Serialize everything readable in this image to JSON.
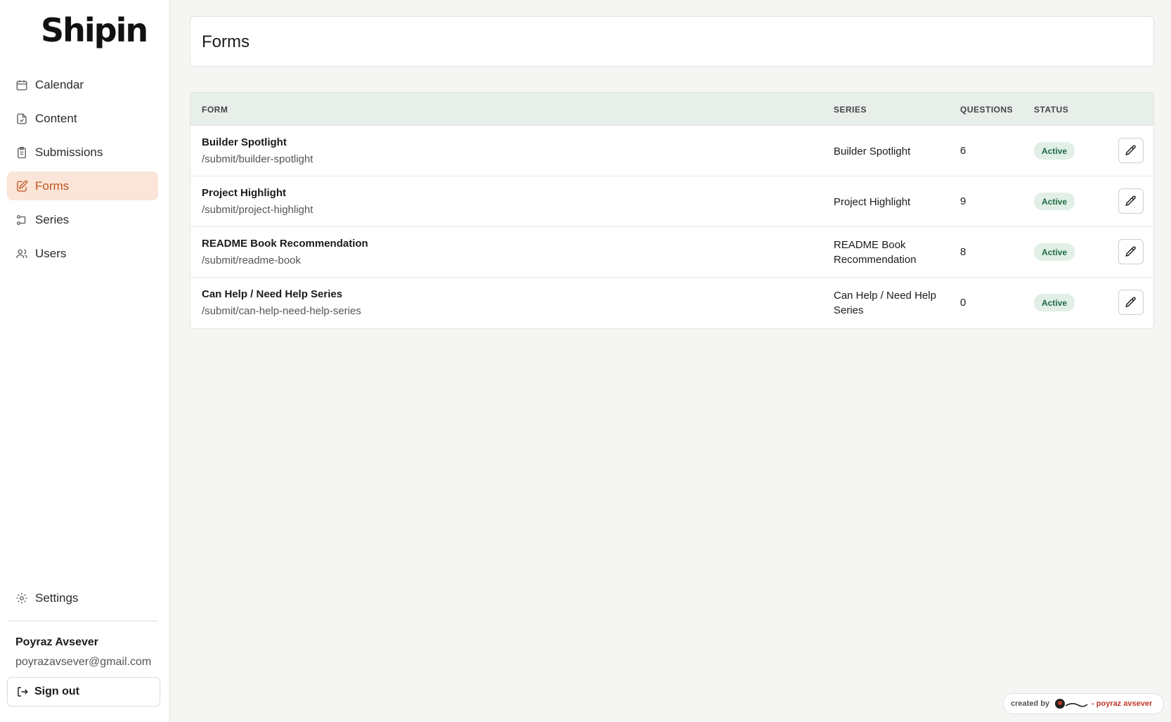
{
  "app": {
    "logo_text": "Shipin"
  },
  "sidebar": {
    "items": [
      {
        "label": "Calendar",
        "icon": "calendar-icon",
        "active": false
      },
      {
        "label": "Content",
        "icon": "document-icon",
        "active": false
      },
      {
        "label": "Submissions",
        "icon": "clipboard-icon",
        "active": false
      },
      {
        "label": "Forms",
        "icon": "edit-form-icon",
        "active": true
      },
      {
        "label": "Series",
        "icon": "series-icon",
        "active": false
      },
      {
        "label": "Users",
        "icon": "users-icon",
        "active": false
      }
    ],
    "settings_label": "Settings",
    "user": {
      "name": "Poyraz Avsever",
      "email": "poyrazavsever@gmail.com"
    },
    "signout_label": "Sign out"
  },
  "page": {
    "title": "Forms"
  },
  "table": {
    "headers": {
      "form": "FORM",
      "series": "SERIES",
      "questions": "QUESTIONS",
      "status": "STATUS"
    },
    "rows": [
      {
        "name": "Builder Spotlight",
        "path": "/submit/builder-spotlight",
        "series": "Builder Spotlight",
        "questions": "6",
        "status": "Active"
      },
      {
        "name": "Project Highlight",
        "path": "/submit/project-highlight",
        "series": "Project Highlight",
        "questions": "9",
        "status": "Active"
      },
      {
        "name": "README Book Recommendation",
        "path": "/submit/readme-book",
        "series": "README Book Recommendation",
        "questions": "8",
        "status": "Active"
      },
      {
        "name": "Can Help / Need Help Series",
        "path": "/submit/can-help-need-help-series",
        "series": "Can Help / Need Help Series",
        "questions": "0",
        "status": "Active"
      }
    ]
  },
  "credit": {
    "prefix": "created by",
    "author": "- poyraz avsever"
  },
  "colors": {
    "accent": "#c0561d",
    "active_bg": "#fbe4d8",
    "badge_bg": "#e1efe6",
    "badge_text": "#1d6a43"
  }
}
